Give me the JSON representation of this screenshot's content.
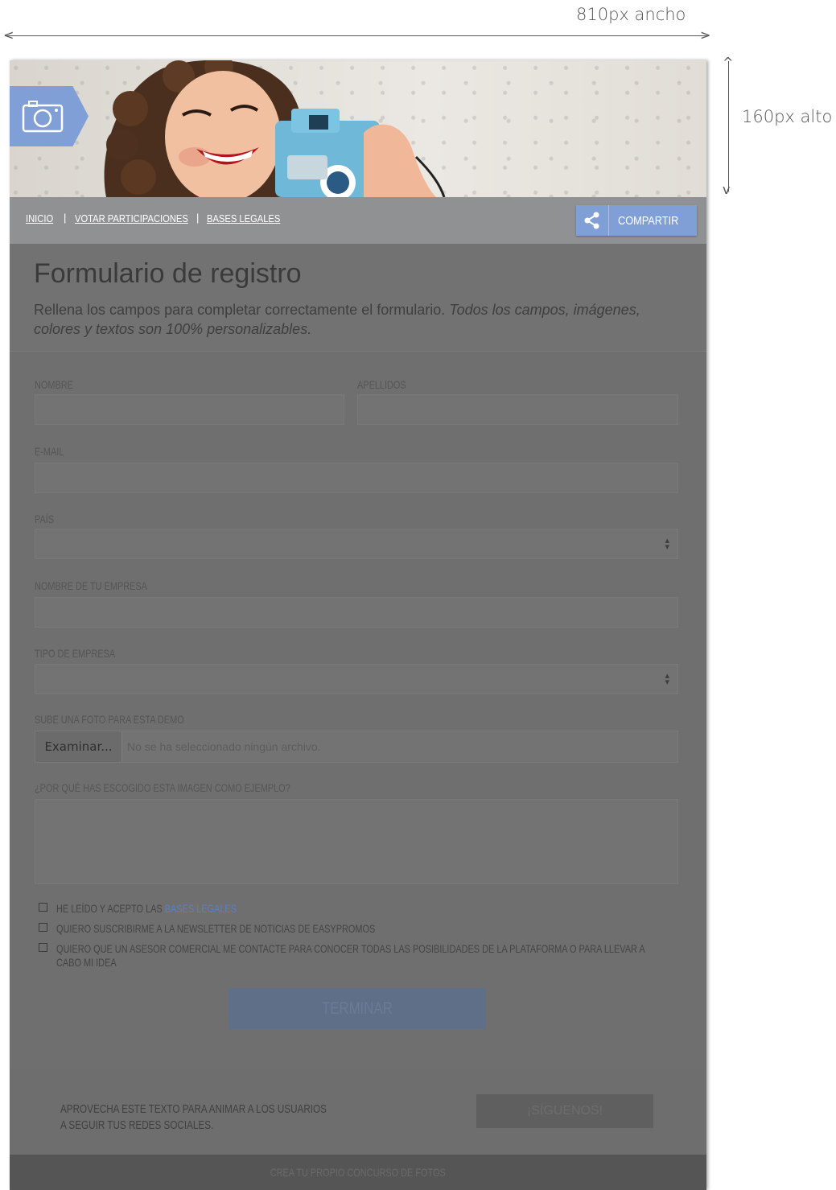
{
  "annotations": {
    "width_label": "810px ancho",
    "height_label": "160px alto"
  },
  "nav": {
    "links": [
      "INICIO",
      "VOTAR PARTICIPACIONES",
      "BASES LEGALES"
    ],
    "share_label": "COMPARTIR"
  },
  "form": {
    "title": "Formulario de registro",
    "subtitle_plain": "Rellena los campos para completar correctamente el formulario. ",
    "subtitle_italic": "Todos los campos, imágenes, colores y textos son 100% personalizables.",
    "labels": {
      "first_name": "NOMBRE",
      "last_name": "APELLIDOS",
      "email": "E-MAIL",
      "country": "PAÍS",
      "company": "NOMBRE DE TU EMPRESA",
      "company_type": "TIPO DE EMPRESA",
      "photo": "SUBE UNA FOTO PARA ESTA DEMO",
      "why": "¿POR QUÉ HAS ESCOGIDO ESTA IMAGEN COMO EJEMPLO?"
    },
    "file_button": "Examinar...",
    "file_status": "No se ha seleccionado ningún archivo.",
    "checks": {
      "terms_prefix": "HE LEÍDO Y ACEPTO LAS ",
      "terms_link": "BASES LEGALES",
      "newsletter": "QUIERO SUSCRIBIRME A LA NEWSLETTER DE NOTICIAS DE EASYPROMOS",
      "contact": "QUIERO QUE UN ASESOR COMERCIAL ME CONTACTE PARA CONOCER TODAS LAS POSIBILIDADES DE LA PLATAFORMA O PARA LLEVAR A CABO MI IDEA"
    },
    "submit_label": "TERMINAR"
  },
  "follow": {
    "line1": "APROVECHA ESTE TEXTO PARA ANIMAR A LOS USUARIOS",
    "line2": "A SEGUIR TUS REDES SOCIALES.",
    "button": "¡SÍGUENOS!"
  },
  "footer": {
    "label": "CREA TU PROPIO CONCURSO DE FOTOS"
  },
  "colors": {
    "accent": "#7f9fd6",
    "overlay": "#6f6f6f",
    "navbar": "#8f9193"
  }
}
